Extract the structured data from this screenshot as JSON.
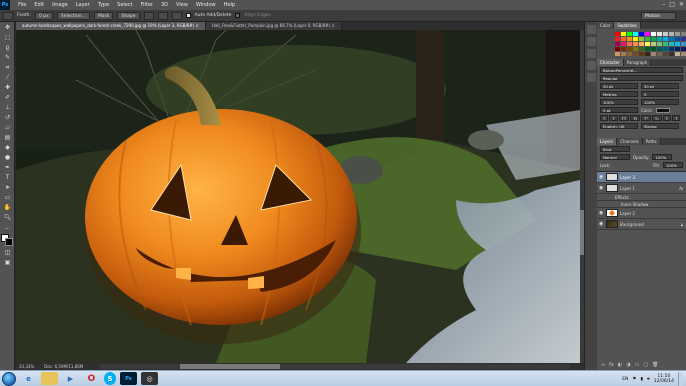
{
  "app": {
    "logo": "Ps"
  },
  "menu": [
    "File",
    "Edit",
    "Image",
    "Layer",
    "Type",
    "Select",
    "Filter",
    "3D",
    "View",
    "Window",
    "Help"
  ],
  "window_controls": [
    "–",
    "□",
    "✕"
  ],
  "options_bar": {
    "feather_label": "Feath:",
    "feather_value": "0 px",
    "selection_button": "Selection...",
    "mask_button": "Mask",
    "shape_button": "Shape",
    "auto_add_delete_label": "Auto Add/Delete",
    "align_edges_label": "Align Edges",
    "workspace": "Motion"
  },
  "tabs": [
    {
      "label": "autumn-landscapes_wallpapers_dark-forest-creek_7290.jpg @ 19% (Layer 3, RGB/8#) ×",
      "active": true
    },
    {
      "label": "Hall_Free&Flutter_Pumpkin.jpg @ 66.7% (Layer 0, RGB/8#) ×",
      "active": false
    }
  ],
  "status": {
    "zoom": "33,33%",
    "doc": "Doc: 6,59M/11,86M"
  },
  "panels": {
    "color_tabs": [
      "Color",
      "Swatches"
    ],
    "character_tabs": [
      "Character",
      "Paragraph"
    ],
    "font_family": "BalcanPersnshtt...",
    "font_style": "Regular",
    "font_size": "30 pt",
    "leading": "30 pt",
    "kerning": "Metrics",
    "tracking": "0",
    "vscale": "100%",
    "hscale": "100%",
    "baseline": "0 pt",
    "color_label": "Color:",
    "language": "English: UK",
    "aa": "Strong",
    "layers_tabs": [
      "Layers",
      "Channels",
      "Paths"
    ],
    "kind_label": "Kind",
    "blend_mode": "Normal",
    "opacity_label": "Opacity:",
    "opacity_value": "100%",
    "lock_label": "Lock:",
    "fill_label": "Fill:",
    "fill_value": "100%",
    "layers": [
      {
        "name": "Layer 3",
        "selected": true
      },
      {
        "name": "Layer 1",
        "selected": false
      },
      {
        "name": "Effects",
        "selected": false
      },
      {
        "name": "Inner Shadow",
        "selected": false
      },
      {
        "name": "Layer 2",
        "selected": false
      },
      {
        "name": "Background",
        "selected": false
      }
    ],
    "fx_icon": "fx"
  },
  "taskbar": {
    "time": "11:50",
    "date": "12/06/14",
    "lang": "EN"
  }
}
